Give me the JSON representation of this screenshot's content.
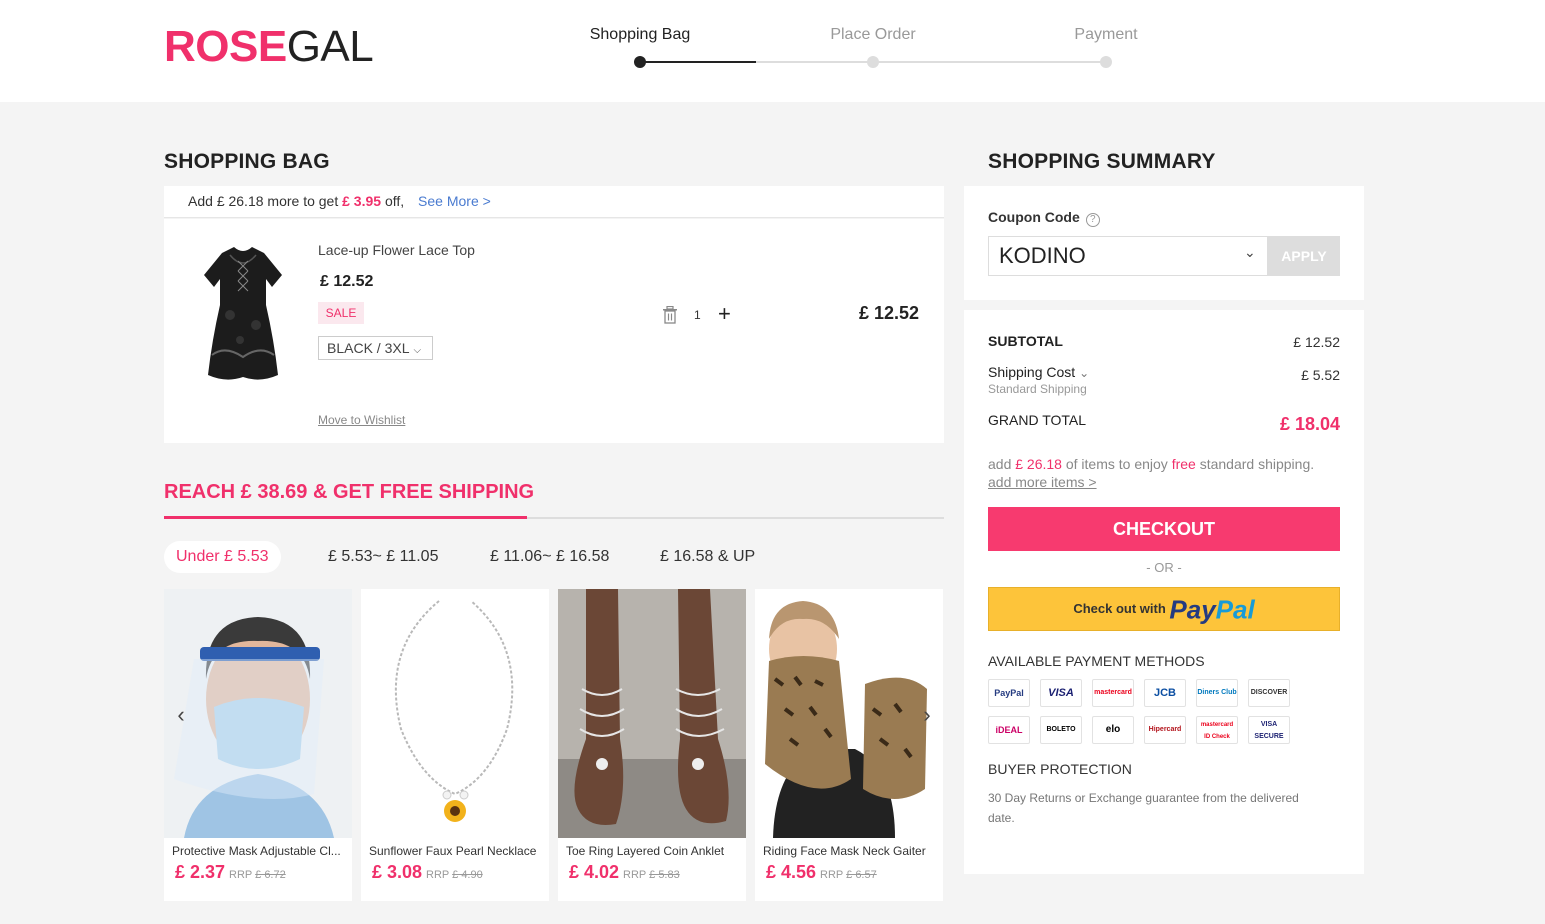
{
  "brand": {
    "logo_part1": "ROSE",
    "logo_part2": "GAL"
  },
  "steps": [
    {
      "label": "Shopping Bag",
      "active": true
    },
    {
      "label": "Place Order",
      "active": false
    },
    {
      "label": "Payment",
      "active": false
    }
  ],
  "bag": {
    "title": "SHOPPING BAG",
    "promo": {
      "prefix": "Add",
      "amount": "£ 26.18 more to get",
      "discount": "£ 3.95",
      "suffix": "off,",
      "link": "See More >"
    },
    "item": {
      "name": "Lace-up Flower Lace Top",
      "price": "£ 12.52",
      "badge": "SALE",
      "variant": "BLACK / 3XL",
      "quantity": "1",
      "line_total": "£ 12.52",
      "wishlist": "Move to Wishlist"
    }
  },
  "free_shipping": {
    "title": "REACH  £ 38.69 & GET FREE SHIPPING",
    "tabs": [
      {
        "label": "Under  £ 5.53",
        "active": true
      },
      {
        "label": "£ 5.53~ £ 11.05",
        "active": false
      },
      {
        "label": "£ 11.06~ £ 16.58",
        "active": false
      },
      {
        "label": "£ 16.58 & UP",
        "active": false
      }
    ],
    "products": [
      {
        "name": "Protective Mask Adjustable Cl...",
        "price": "£ 2.37",
        "rrp_label": "RRP",
        "rrp": "£ 6.72"
      },
      {
        "name": "Sunflower Faux Pearl Necklace",
        "price": "£ 3.08",
        "rrp_label": "RRP",
        "rrp": "£ 4.90"
      },
      {
        "name": "Toe Ring Layered Coin Anklet",
        "price": "£ 4.02",
        "rrp_label": "RRP",
        "rrp": "£ 5.83"
      },
      {
        "name": "Riding Face Mask Neck Gaiter",
        "price": "£ 4.56",
        "rrp_label": "RRP",
        "rrp": "£ 6.57"
      }
    ]
  },
  "summary": {
    "title": "SHOPPING SUMMARY",
    "coupon_label": "Coupon Code",
    "coupon_value": "KODINO",
    "apply_label": "APPLY",
    "subtotal_label": "SUBTOTAL",
    "subtotal_value": "£ 12.52",
    "shipping_label": "Shipping Cost",
    "shipping_sub": "Standard Shipping",
    "shipping_value": "£ 5.52",
    "grand_label": "GRAND TOTAL",
    "grand_value": "£ 18.04",
    "free_note": {
      "prefix": "add",
      "amount": "£ 26.18",
      "middle": "of items to enjoy",
      "free": "free",
      "suffix": "standard shipping.",
      "link": "add more items >"
    },
    "checkout_label": "CHECKOUT",
    "or_label": "- OR -",
    "paypal_prefix": "Check out with",
    "paypal_a": "Pay",
    "paypal_b": "Pal",
    "payment_methods_title": "AVAILABLE PAYMENT METHODS",
    "payment_methods": [
      "PayPal",
      "VISA",
      "mastercard",
      "JCB",
      "Diners Club",
      "DISCOVER",
      "iDEAL",
      "BOLETO",
      "elo",
      "Hipercard",
      "mastercard ID Check",
      "VISA SECURE"
    ],
    "buyer_title": "BUYER PROTECTION",
    "buyer_text": "30 Day Returns or Exchange guarantee from the delivered date."
  },
  "colors": {
    "brand_pink": "#f0306b",
    "checkout": "#f73a6f",
    "paypal_yellow": "#fdc43a"
  }
}
